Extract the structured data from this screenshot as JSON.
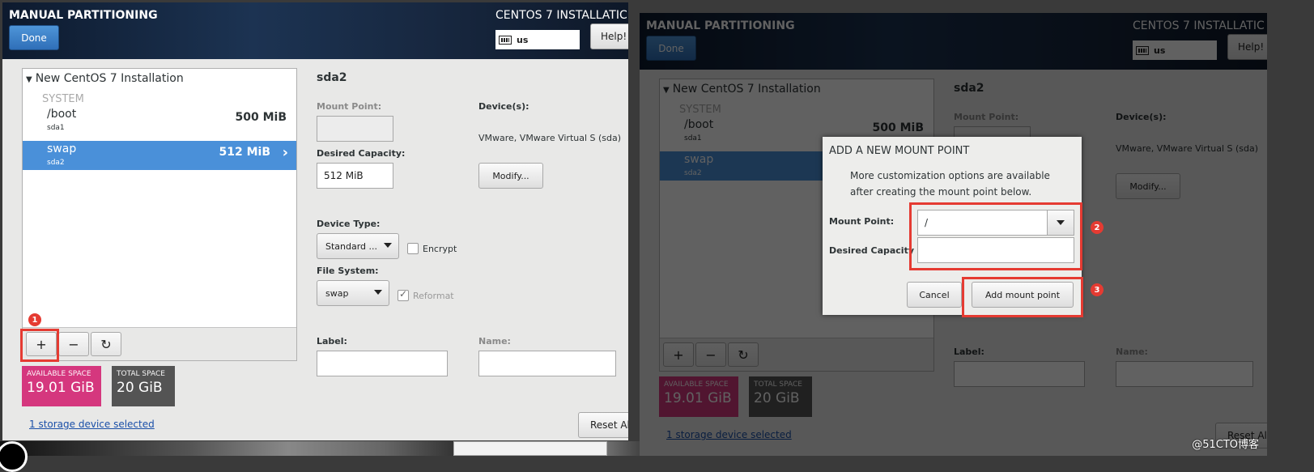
{
  "header": {
    "title": "MANUAL PARTITIONING",
    "installer_title": "CENTOS 7 INSTALLATIC",
    "done_label": "Done",
    "keyboard_layout": "us",
    "help_label": "Help!"
  },
  "tree": {
    "installation_label": "New CentOS 7 Installation",
    "group_label": "SYSTEM",
    "partitions": [
      {
        "mount": "/boot",
        "device": "sda1",
        "size": "500 MiB",
        "selected": false
      },
      {
        "mount": "swap",
        "device": "sda2",
        "size": "512 MiB",
        "selected": true
      }
    ]
  },
  "toolbar": {
    "add_label": "+",
    "remove_label": "−",
    "refresh_icon": "refresh-icon"
  },
  "space": {
    "available_label": "AVAILABLE SPACE",
    "available_value": "19.01 GiB",
    "total_label": "TOTAL SPACE",
    "total_value": "20 GiB"
  },
  "storage_link": "1 storage device selected",
  "reset_label": "Reset Al",
  "details": {
    "title": "sda2",
    "mount_point_label": "Mount Point:",
    "mount_point_value": "",
    "devices_label": "Device(s):",
    "devices_value": "VMware, VMware Virtual S (sda)",
    "capacity_label": "Desired Capacity:",
    "capacity_value": "512 MiB",
    "modify_label": "Modify...",
    "device_type_label": "Device Type:",
    "device_type_value": "Standard ...",
    "encrypt_label": "Encrypt",
    "file_system_label": "File System:",
    "file_system_value": "swap",
    "reformat_label": "Reformat",
    "label_label": "Label:",
    "name_label": "Name:"
  },
  "dialog": {
    "title": "ADD A NEW MOUNT POINT",
    "description": "More customization options are available after creating the mount point below.",
    "mount_point_label": "Mount Point:",
    "mount_point_value": "/",
    "capacity_label": "Desired Capacity",
    "capacity_value": "",
    "cancel_label": "Cancel",
    "add_label": "Add mount point"
  },
  "annotations": {
    "badge_1": "1",
    "badge_2": "2",
    "badge_3": "3"
  },
  "watermark": "@51CTO博客",
  "colors": {
    "selection_blue": "#4a90d9",
    "available_pink": "#d5377e",
    "total_gray": "#545454",
    "annotation_red": "#e53b32"
  }
}
